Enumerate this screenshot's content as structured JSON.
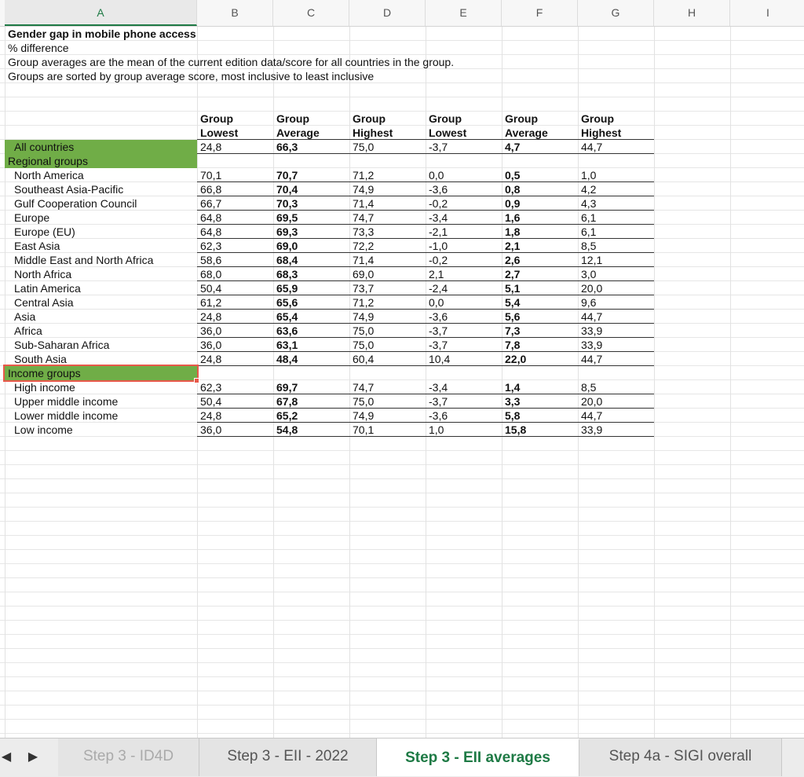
{
  "columns": [
    "A",
    "B",
    "C",
    "D",
    "E",
    "F",
    "G",
    "H",
    "I"
  ],
  "active_column": "A",
  "text_rows": {
    "title": "Gender gap in mobile phone access",
    "subtitle": "% difference",
    "note1": "Group averages are the mean of the current edition data/score for all countries in the group.",
    "note2": "Groups are sorted by group average score, most inclusive to least inclusive"
  },
  "headers": [
    [
      "Group",
      "Lowest"
    ],
    [
      "Group",
      "Average"
    ],
    [
      "Group",
      "Highest"
    ],
    [
      "Group",
      "Lowest"
    ],
    [
      "Group",
      "Average"
    ],
    [
      "Group",
      "Highest"
    ]
  ],
  "all_countries": {
    "label": "All countries",
    "values": [
      "24,8",
      "66,3",
      "75,0",
      "-3,7",
      "4,7",
      "44,7"
    ]
  },
  "regional_label": "Regional groups",
  "regional": [
    {
      "label": "North America",
      "values": [
        "70,1",
        "70,7",
        "71,2",
        "0,0",
        "0,5",
        "1,0"
      ]
    },
    {
      "label": "Southeast Asia-Pacific",
      "values": [
        "66,8",
        "70,4",
        "74,9",
        "-3,6",
        "0,8",
        "4,2"
      ]
    },
    {
      "label": "Gulf Cooperation Council",
      "values": [
        "66,7",
        "70,3",
        "71,4",
        "-0,2",
        "0,9",
        "4,3"
      ]
    },
    {
      "label": "Europe",
      "values": [
        "64,8",
        "69,5",
        "74,7",
        "-3,4",
        "1,6",
        "6,1"
      ]
    },
    {
      "label": "Europe (EU)",
      "values": [
        "64,8",
        "69,3",
        "73,3",
        "-2,1",
        "1,8",
        "6,1"
      ]
    },
    {
      "label": "East Asia",
      "values": [
        "62,3",
        "69,0",
        "72,2",
        "-1,0",
        "2,1",
        "8,5"
      ]
    },
    {
      "label": "Middle East and North Africa",
      "values": [
        "58,6",
        "68,4",
        "71,4",
        "-0,2",
        "2,6",
        "12,1"
      ]
    },
    {
      "label": "North Africa",
      "values": [
        "68,0",
        "68,3",
        "69,0",
        "2,1",
        "2,7",
        "3,0"
      ]
    },
    {
      "label": "Latin America",
      "values": [
        "50,4",
        "65,9",
        "73,7",
        "-2,4",
        "5,1",
        "20,0"
      ]
    },
    {
      "label": "Central Asia",
      "values": [
        "61,2",
        "65,6",
        "71,2",
        "0,0",
        "5,4",
        "9,6"
      ]
    },
    {
      "label": "Asia",
      "values": [
        "24,8",
        "65,4",
        "74,9",
        "-3,6",
        "5,6",
        "44,7"
      ]
    },
    {
      "label": "Africa",
      "values": [
        "36,0",
        "63,6",
        "75,0",
        "-3,7",
        "7,3",
        "33,9"
      ]
    },
    {
      "label": "Sub-Saharan Africa",
      "values": [
        "36,0",
        "63,1",
        "75,0",
        "-3,7",
        "7,8",
        "33,9"
      ]
    },
    {
      "label": "South Asia",
      "values": [
        "24,8",
        "48,4",
        "60,4",
        "10,4",
        "22,0",
        "44,7"
      ]
    }
  ],
  "income_label": "Income groups",
  "income": [
    {
      "label": "High income",
      "values": [
        "62,3",
        "69,7",
        "74,7",
        "-3,4",
        "1,4",
        "8,5"
      ]
    },
    {
      "label": "Upper middle income",
      "values": [
        "50,4",
        "67,8",
        "75,0",
        "-3,7",
        "3,3",
        "20,0"
      ]
    },
    {
      "label": "Lower middle income",
      "values": [
        "24,8",
        "65,2",
        "74,9",
        "-3,6",
        "5,8",
        "44,7"
      ]
    },
    {
      "label": "Low income",
      "values": [
        "36,0",
        "54,8",
        "70,1",
        "1,0",
        "15,8",
        "33,9"
      ]
    }
  ],
  "tabs": [
    {
      "label": "Step 3 - ID4D",
      "active": false
    },
    {
      "label": "Step 3 - EII - 2022",
      "active": false
    },
    {
      "label": "Step 3 - EII averages",
      "active": true
    },
    {
      "label": "Step 4a - SIGI overall",
      "active": false
    }
  ],
  "nav": {
    "prev_icon": "◀",
    "next_icon": "▶"
  },
  "colors": {
    "green_fill": "#70ad47",
    "selection": "#e8584a",
    "active_tab": "#1e7a45"
  }
}
